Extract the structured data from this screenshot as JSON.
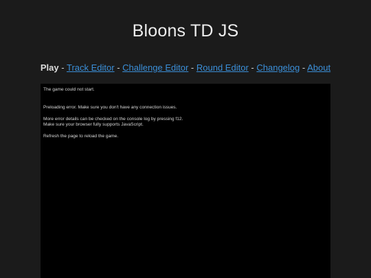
{
  "header": {
    "title": "Bloons TD JS"
  },
  "nav": {
    "current": "Play",
    "separator": "-",
    "links": [
      {
        "label": "Track Editor"
      },
      {
        "label": "Challenge Editor"
      },
      {
        "label": "Round Editor"
      },
      {
        "label": "Changelog"
      },
      {
        "label": "About"
      }
    ]
  },
  "game": {
    "messages": [
      "The game could not start.",
      "Preloading error. Make sure you don't have any connection issues.",
      "More error details can be checked on the console log by pressing f12.",
      "Make sure your browser fully supports JavaScript.",
      "Refresh the page to reload the game."
    ]
  },
  "colors": {
    "background": "#1b1b1b",
    "game_background": "#000000",
    "link": "#3b8fd8",
    "text": "#ededed"
  }
}
